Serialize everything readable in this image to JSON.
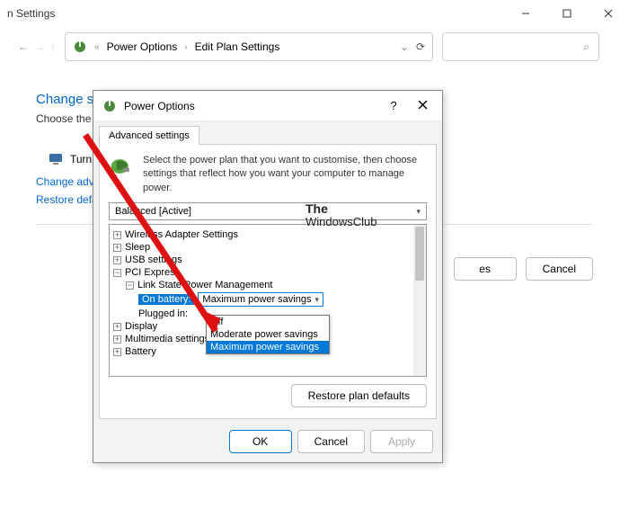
{
  "window": {
    "title_suffix": "n Settings",
    "breadcrumb": {
      "icon": "power-icon",
      "sep": "«",
      "p1": "Power Options",
      "p2": "Edit Plan Settings"
    }
  },
  "page": {
    "heading": "Change se",
    "subheading": "Choose the s",
    "turnoff_label": "Turn off",
    "link_advanced": "Change adva",
    "link_restore": "Restore defa",
    "btn_es": "es",
    "btn_cancel": "Cancel"
  },
  "dialog": {
    "title": "Power Options",
    "tab": "Advanced settings",
    "intro": "Select the power plan that you want to customise, then choose settings that reflect how you want your computer to manage power.",
    "plan_selected": "Balanced [Active]",
    "tree": {
      "wireless": "Wireless Adapter Settings",
      "sleep": "Sleep",
      "usb": "USB settings",
      "pci": "PCI Express",
      "link_state": "Link State Power Management",
      "on_battery_label": "On battery:",
      "on_battery_value": "Maximum power savings",
      "plugged_label": "Plugged in:",
      "display": "Display",
      "multimedia": "Multimedia settings",
      "battery": "Battery"
    },
    "dropdown": {
      "opt1": "Off",
      "opt2": "Moderate power savings",
      "opt3": "Maximum power savings"
    },
    "restore_defaults": "Restore plan defaults",
    "ok": "OK",
    "cancel": "Cancel",
    "apply": "Apply",
    "help": "?"
  },
  "watermark": {
    "line1": "The",
    "line2": "WindowsClub"
  }
}
